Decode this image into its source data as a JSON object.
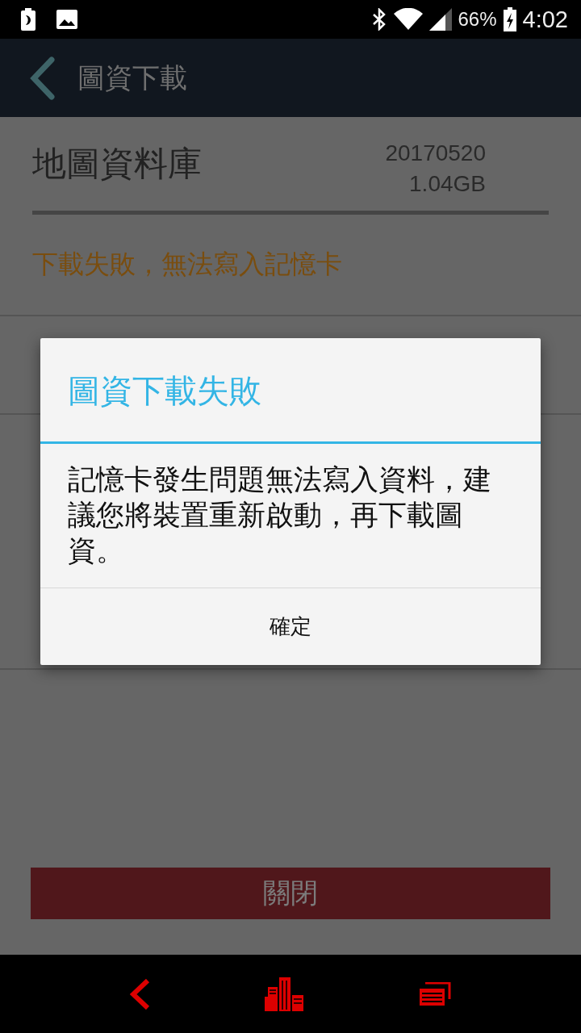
{
  "status_bar": {
    "battery": "66%",
    "time": "4:02"
  },
  "app_bar": {
    "title": "圖資下載"
  },
  "database": {
    "name": "地圖資料庫",
    "version": "20170520",
    "size": "1.04GB"
  },
  "error_message": "下載失敗，無法寫入記憶卡",
  "close_button": "關閉",
  "dialog": {
    "title": "圖資下載失敗",
    "message": "記憶卡發生問題無法寫入資料，建議您將裝置重新啟動，再下載圖資。",
    "buttons": [
      "確定"
    ]
  }
}
